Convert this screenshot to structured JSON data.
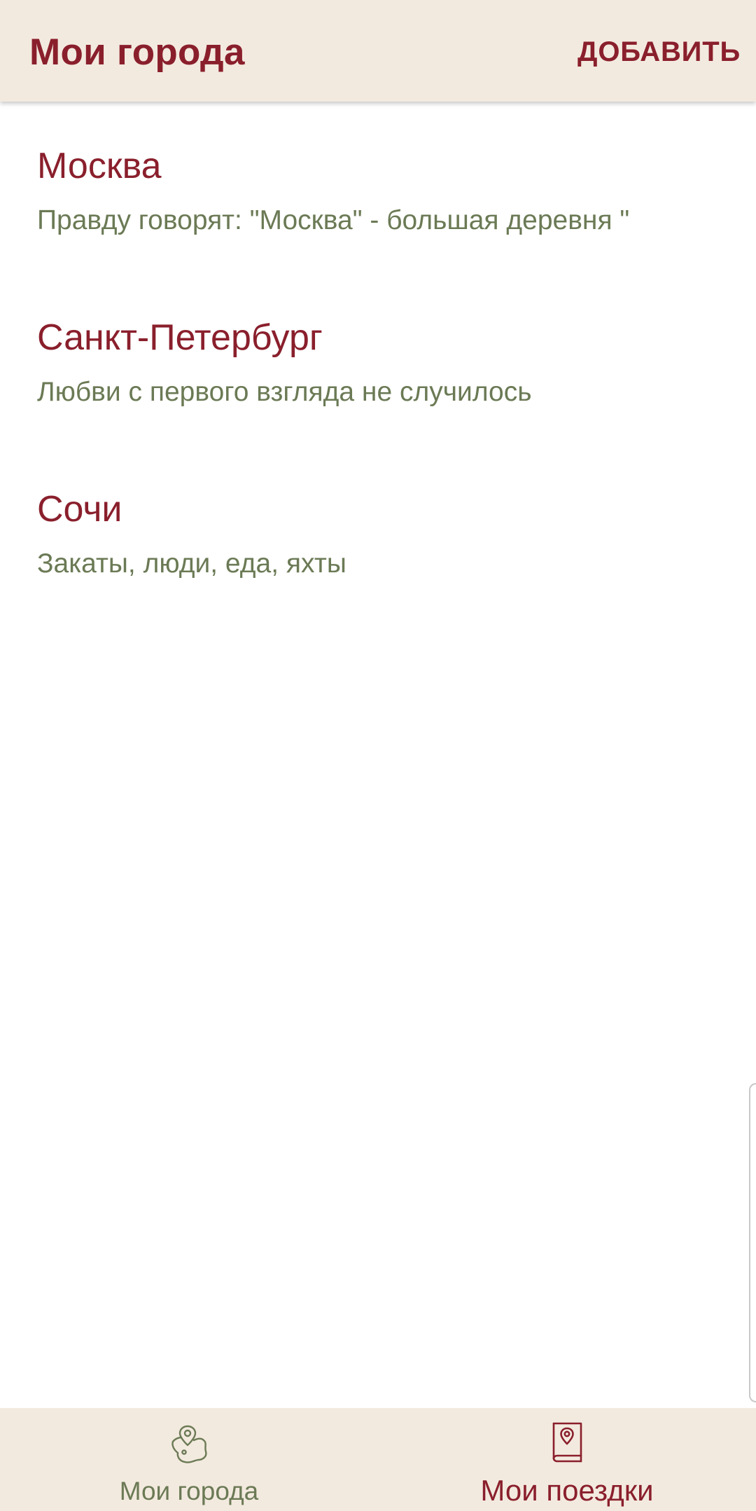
{
  "header": {
    "title": "Мои города",
    "add_label": "ДОБАВИТЬ"
  },
  "cities": [
    {
      "name": "Москва",
      "description": "Правду говорят: \"Москва\" - большая деревня \""
    },
    {
      "name": "Санкт-Петербург",
      "description": "Любви с первого взгляда не случилось"
    },
    {
      "name": "Сочи",
      "description": "Закаты, люди, еда, яхты"
    }
  ],
  "bottom_nav": {
    "items": [
      {
        "label": "Мои города",
        "icon": "city-map-pin-icon",
        "active": false
      },
      {
        "label": "Мои поездки",
        "icon": "travel-book-icon",
        "active": true
      }
    ]
  },
  "colors": {
    "primary": "#8a1f2c",
    "secondary": "#6b7a55",
    "bar_background": "#f3eadf",
    "background": "#ffffff"
  }
}
